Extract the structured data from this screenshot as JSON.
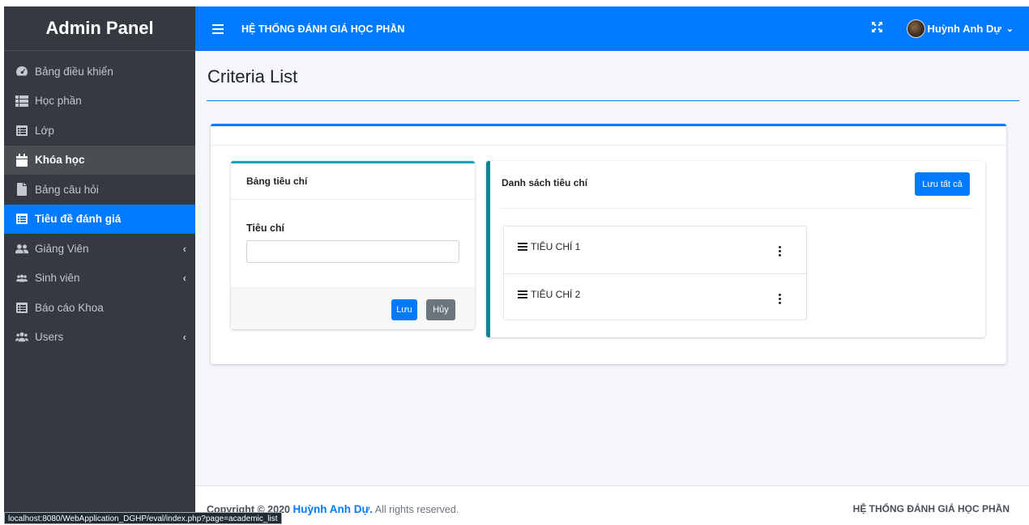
{
  "sidebar": {
    "brand": "Admin Panel",
    "items": [
      {
        "label": "Bảng điều khiển",
        "icon": "tachometer-icon"
      },
      {
        "label": "Học phần",
        "icon": "th-list-icon"
      },
      {
        "label": "Lớp",
        "icon": "list-alt-icon"
      },
      {
        "label": "Khóa học",
        "icon": "calendar-icon"
      },
      {
        "label": "Bảng câu hỏi",
        "icon": "file-icon"
      },
      {
        "label": "Tiêu đề đánh giá",
        "icon": "list-alt-icon"
      },
      {
        "label": "Giảng Viên",
        "icon": "user-friends-icon"
      },
      {
        "label": "Sinh viên",
        "icon": "users-icon"
      },
      {
        "label": "Báo cáo Khoa",
        "icon": "list-alt-icon"
      },
      {
        "label": "Users",
        "icon": "users-cog-icon"
      }
    ]
  },
  "topbar": {
    "title": "HỆ THỐNG ĐÁNH GIÁ HỌC PHẦN",
    "user_name": "Huỳnh Anh Dự"
  },
  "main": {
    "page_title": "Criteria List",
    "form_card": {
      "title": "Bảng tiêu chí",
      "field_label": "Tiêu chí",
      "field_value": "",
      "save_label": "Lưu",
      "cancel_label": "Hủy"
    },
    "list_card": {
      "title": "Danh sách tiêu chí",
      "save_all_label": "Lưu tất cả",
      "items": [
        "TIÊU CHÍ 1",
        "TIÊU CHÍ 2"
      ]
    }
  },
  "footer": {
    "copyright_prefix": "Copyright © 2020",
    "author": "Huỳnh Anh Dự.",
    "rights": "All rights reserved.",
    "right_text": "HỆ THỐNG ĐÁNH GIÁ HỌC PHẦN"
  },
  "statusbar": {
    "url": "localhost:8080/WebApplication_DGHP/eval/index.php?page=academic_list"
  },
  "colors": {
    "primary": "#007bff",
    "sidebar_bg": "#343a40",
    "info": "#17a2b8",
    "secondary": "#6c757d"
  }
}
